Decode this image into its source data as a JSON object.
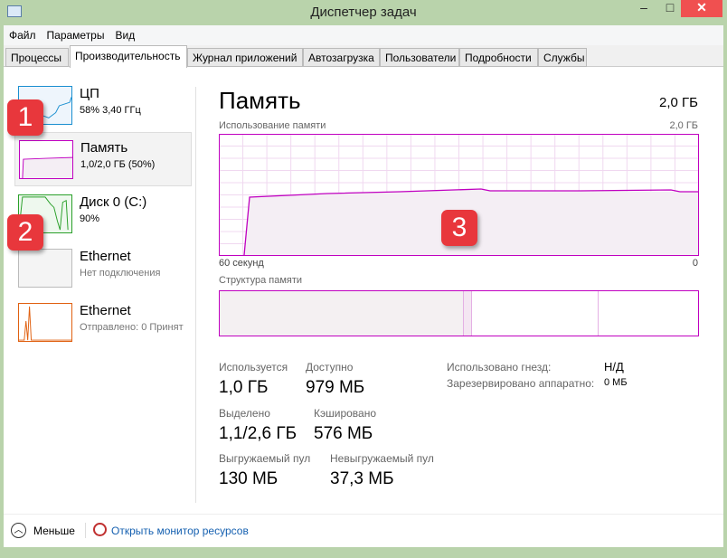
{
  "window": {
    "title": "Диспетчер задач",
    "minimize": "–",
    "maximize": "□",
    "close": "✕"
  },
  "menu": [
    "Файл",
    "Параметры",
    "Вид"
  ],
  "tabs": [
    "Процессы",
    "Производительность",
    "Журнал приложений",
    "Автозагрузка",
    "Пользователи",
    "Подробности",
    "Службы"
  ],
  "sidebar": [
    {
      "name": "ЦП",
      "sub": "58% 3,40 ГГц"
    },
    {
      "name": "Память",
      "sub": "1,0/2,0 ГБ (50%)"
    },
    {
      "name": "Диск 0 (C:)",
      "sub": "90%"
    },
    {
      "name": "Ethernet",
      "sub": "Нет подключения"
    },
    {
      "name": "Ethernet",
      "sub": "Отправлено: 0 Принят"
    }
  ],
  "badges": [
    "1",
    "2",
    "3"
  ],
  "main": {
    "title": "Память",
    "total": "2,0 ГБ",
    "usage_label": "Использование памяти",
    "usage_max": "2,0 ГБ",
    "axis_left": "60 секунд",
    "axis_right": "0",
    "structure_label": "Структура памяти",
    "usage_fraction": 0.5,
    "stats": [
      {
        "label": "Используется",
        "value": "1,0 ГБ"
      },
      {
        "label": "Доступно",
        "value": "979 МБ"
      },
      {
        "label": "Выделено",
        "value": "1,1/2,6 ГБ"
      },
      {
        "label": "Кэшировано",
        "value": "576 МБ"
      },
      {
        "label": "Выгружаемый пул",
        "value": "130 МБ"
      },
      {
        "label": "Невыгружаемый пул",
        "value": "37,3 МБ"
      }
    ],
    "side_stats": [
      {
        "label": "Использовано гнезд:",
        "value": "Н/Д"
      },
      {
        "label": "Зарезервировано аппаратно:",
        "value": "0 МБ"
      }
    ]
  },
  "footer": {
    "less": "Меньше",
    "monitor": "Открыть монитор ресурсов"
  },
  "colors": {
    "memory": "#c000c0",
    "cpu": "#1a8fd0",
    "disk": "#2aa02a",
    "eth": "#e06010",
    "badge": "#e8373c"
  }
}
